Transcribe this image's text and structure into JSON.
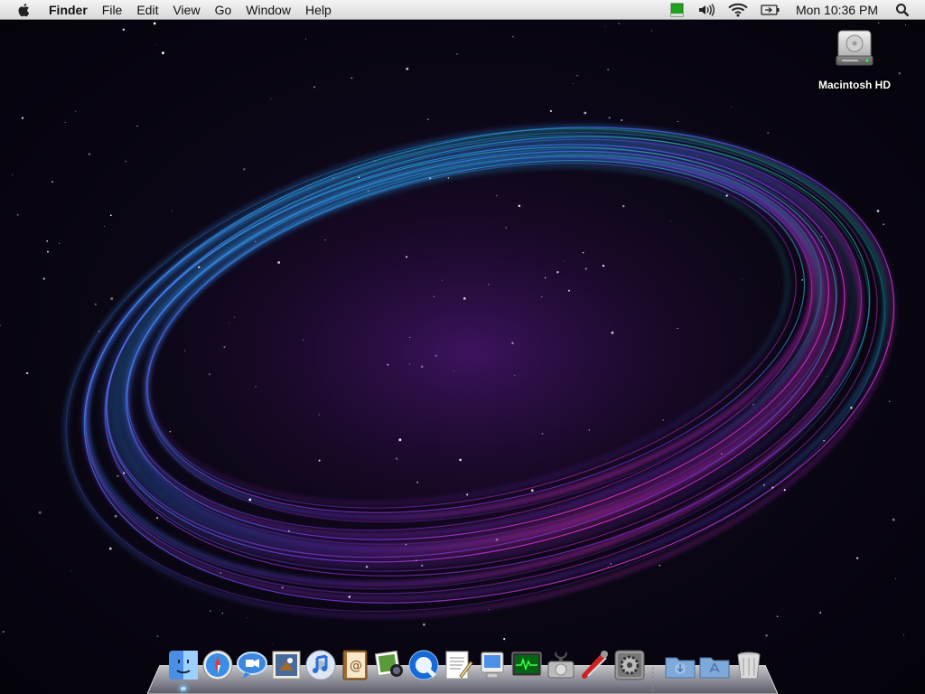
{
  "menubar": {
    "app_name": "Finder",
    "items": [
      "File",
      "Edit",
      "View",
      "Go",
      "Window",
      "Help"
    ],
    "clock": "Mon 10:36 PM",
    "status_icons": [
      "battery-level-icon",
      "volume-icon",
      "wifi-icon",
      "battery-icon",
      "spotlight-icon"
    ]
  },
  "desktop": {
    "drive_label": "Macintosh HD"
  },
  "dock": {
    "items": [
      "finder-icon",
      "safari-icon",
      "ichat-icon",
      "mail-icon",
      "itunes-icon",
      "address-book-icon",
      "iphoto-icon",
      "quicktime-icon",
      "textedit-icon",
      "system-profiler-icon",
      "activity-monitor-icon",
      "disk-utility-icon",
      "utilities-icon",
      "system-preferences-icon",
      "downloads-stack-icon",
      "applications-stack-icon",
      "trash-icon"
    ]
  },
  "colors": {
    "menubar_bg": "#e6e6e6",
    "wallpaper_cyan": "#1fd3ff",
    "wallpaper_magenta": "#e43cff",
    "wallpaper_violet": "#7a3cff",
    "wallpaper_green": "#2cff7a"
  }
}
